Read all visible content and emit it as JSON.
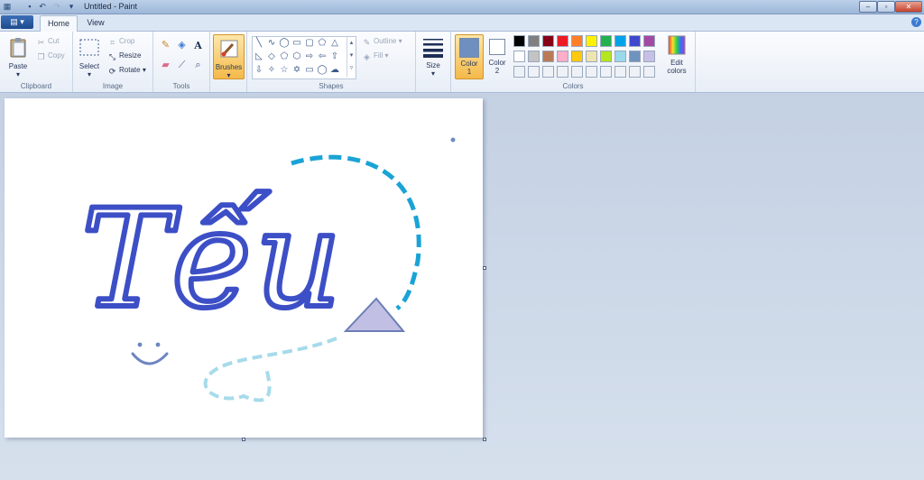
{
  "window": {
    "title": "Untitled - Paint"
  },
  "tabs": {
    "file": "▤ ▾",
    "home": "Home",
    "view": "View"
  },
  "clipboard": {
    "paste": "Paste",
    "cut": "Cut",
    "copy": "Copy",
    "group": "Clipboard"
  },
  "image": {
    "select": "Select",
    "crop": "Crop",
    "resize": "Resize",
    "rotate": "Rotate",
    "group": "Image"
  },
  "tools": {
    "group": "Tools"
  },
  "brushes": {
    "label": "Brushes"
  },
  "shapes": {
    "outline": "Outline",
    "fill": "Fill",
    "group": "Shapes"
  },
  "size": {
    "label": "Size"
  },
  "colors": {
    "color1_label": "Color 1",
    "color2_label": "Color 2",
    "color1": "#6e8fc0",
    "color2": "#ffffff",
    "edit": "Edit colors",
    "group": "Colors",
    "palette_row1": [
      "#000000",
      "#7f7f7f",
      "#880015",
      "#ed1c24",
      "#ff7f27",
      "#fff200",
      "#22b14c",
      "#00a2e8",
      "#3f48cc",
      "#a349a4"
    ],
    "palette_row2": [
      "#ffffff",
      "#c3c3c3",
      "#b97a57",
      "#ffaec9",
      "#ffc90e",
      "#efe4b0",
      "#b5e61d",
      "#99d9ea",
      "#7092be",
      "#c8bfe7"
    ]
  },
  "drawing": {
    "text": "Tếu"
  }
}
